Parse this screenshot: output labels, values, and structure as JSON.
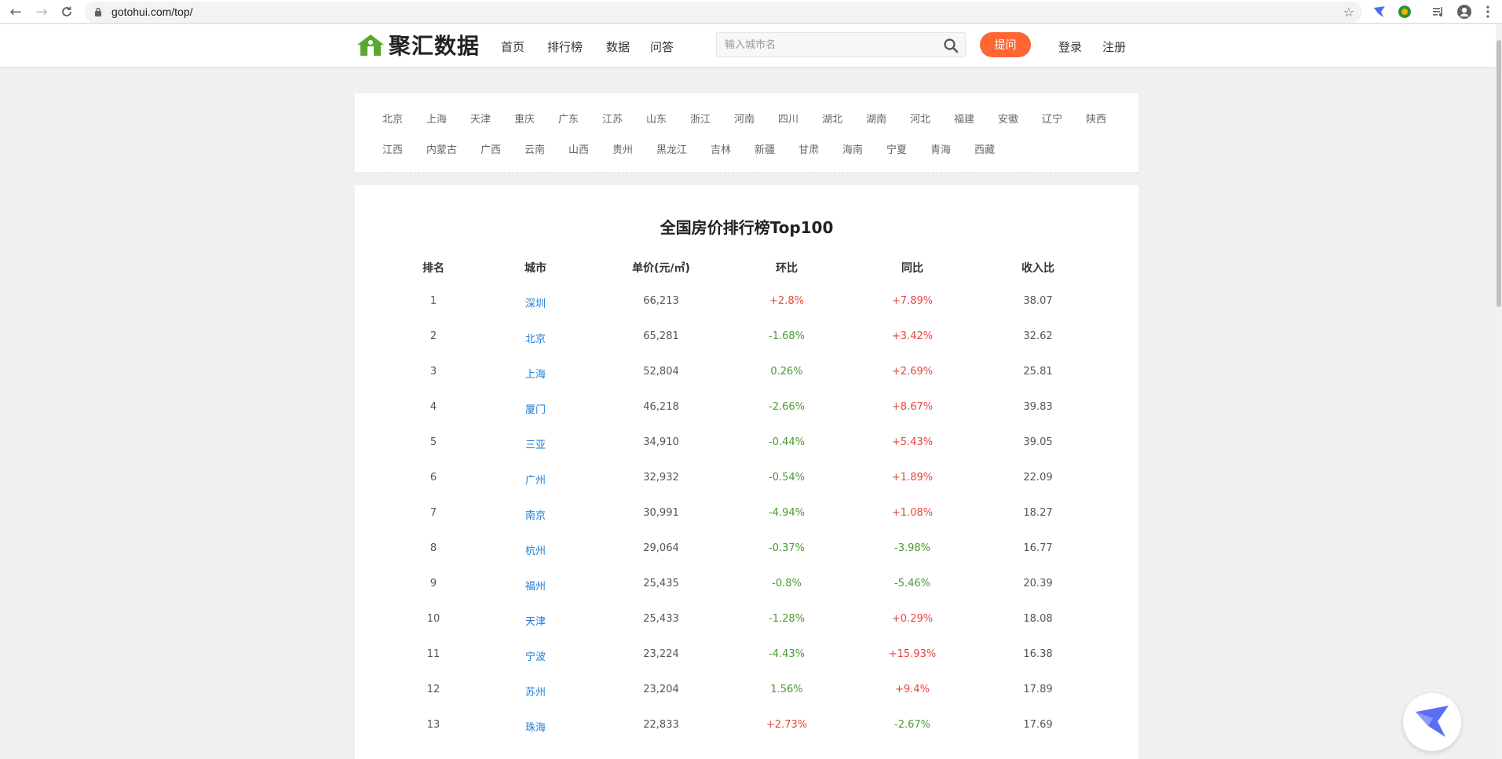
{
  "browser": {
    "url": "gotohui.com/top/"
  },
  "site": {
    "brand": "聚汇数据",
    "nav": [
      "首页",
      "排行榜",
      "数据",
      "问答"
    ],
    "search_placeholder": "输入城市名",
    "ask_button": "提问",
    "login": "登录",
    "register": "注册"
  },
  "provinces": {
    "row1": [
      "北京",
      "上海",
      "天津",
      "重庆",
      "广东",
      "江苏",
      "山东",
      "浙江",
      "河南",
      "四川",
      "湖北",
      "湖南",
      "河北",
      "福建",
      "安徽",
      "辽宁",
      "陕西"
    ],
    "row2": [
      "江西",
      "内蒙古",
      "广西",
      "云南",
      "山西",
      "贵州",
      "黑龙江",
      "吉林",
      "新疆",
      "甘肃",
      "海南",
      "宁夏",
      "青海",
      "西藏"
    ]
  },
  "ranking": {
    "title": "全国房价排行榜Top100",
    "headers": {
      "rank": "排名",
      "city": "城市",
      "price": "单价(元/㎡)",
      "mom": "环比",
      "yoy": "同比",
      "ratio": "收入比"
    },
    "rows": [
      {
        "rank": "1",
        "city": "深圳",
        "price": "66,213",
        "mom": "+2.8%",
        "yoy": "+7.89%",
        "ratio": "38.07"
      },
      {
        "rank": "2",
        "city": "北京",
        "price": "65,281",
        "mom": "-1.68%",
        "yoy": "+3.42%",
        "ratio": "32.62"
      },
      {
        "rank": "3",
        "city": "上海",
        "price": "52,804",
        "mom": "0.26%",
        "yoy": "+2.69%",
        "ratio": "25.81"
      },
      {
        "rank": "4",
        "city": "厦门",
        "price": "46,218",
        "mom": "-2.66%",
        "yoy": "+8.67%",
        "ratio": "39.83"
      },
      {
        "rank": "5",
        "city": "三亚",
        "price": "34,910",
        "mom": "-0.44%",
        "yoy": "+5.43%",
        "ratio": "39.05"
      },
      {
        "rank": "6",
        "city": "广州",
        "price": "32,932",
        "mom": "-0.54%",
        "yoy": "+1.89%",
        "ratio": "22.09"
      },
      {
        "rank": "7",
        "city": "南京",
        "price": "30,991",
        "mom": "-4.94%",
        "yoy": "+1.08%",
        "ratio": "18.27"
      },
      {
        "rank": "8",
        "city": "杭州",
        "price": "29,064",
        "mom": "-0.37%",
        "yoy": "-3.98%",
        "ratio": "16.77"
      },
      {
        "rank": "9",
        "city": "福州",
        "price": "25,435",
        "mom": "-0.8%",
        "yoy": "-5.46%",
        "ratio": "20.39"
      },
      {
        "rank": "10",
        "city": "天津",
        "price": "25,433",
        "mom": "-1.28%",
        "yoy": "+0.29%",
        "ratio": "18.08"
      },
      {
        "rank": "11",
        "city": "宁波",
        "price": "23,224",
        "mom": "-4.43%",
        "yoy": "+15.93%",
        "ratio": "16.38"
      },
      {
        "rank": "12",
        "city": "苏州",
        "price": "23,204",
        "mom": "1.56%",
        "yoy": "+9.4%",
        "ratio": "17.89"
      },
      {
        "rank": "13",
        "city": "珠海",
        "price": "22,833",
        "mom": "+2.73%",
        "yoy": "-2.67%",
        "ratio": "17.69"
      }
    ]
  },
  "colors": {
    "up": "#e8453c",
    "down": "#4a9a2e",
    "link": "#1e7fd6",
    "accent": "#ff6633"
  }
}
